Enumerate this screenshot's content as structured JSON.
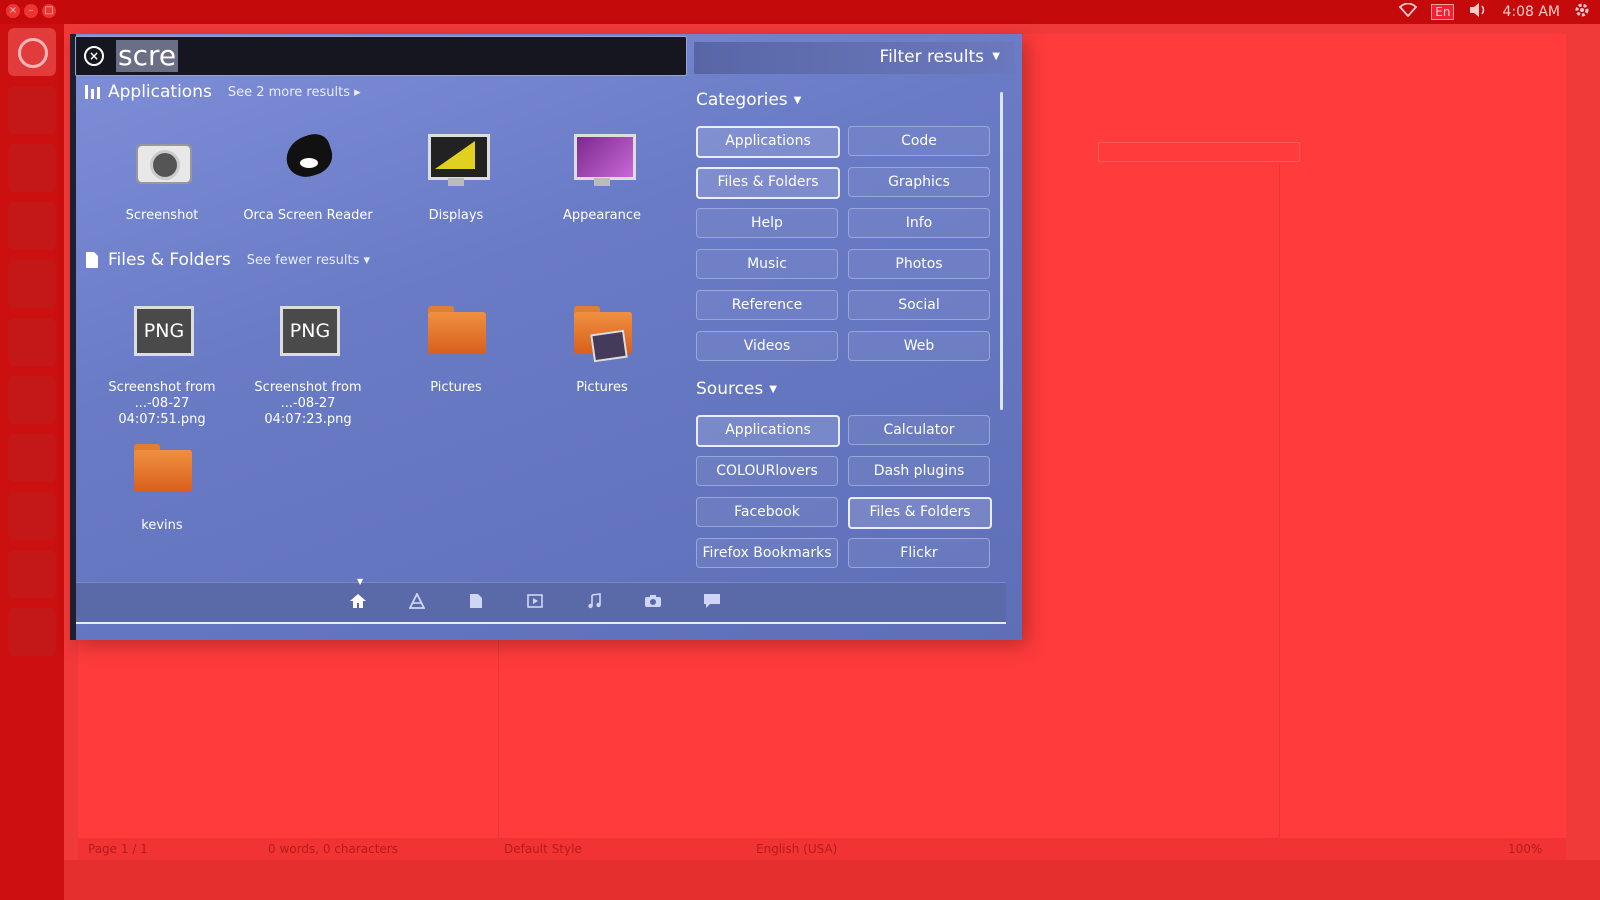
{
  "top_panel": {
    "language": "En",
    "clock": "4:08 AM"
  },
  "icons": {
    "wifi": "wifi-icon",
    "volume": "volume-icon",
    "gear": "gear-icon",
    "close": "close-icon",
    "home": "home-icon"
  },
  "search": {
    "query": "scre"
  },
  "filter": {
    "label": "Filter results"
  },
  "applications_section": {
    "title": "Applications",
    "more": "See 2 more results",
    "items": [
      {
        "label": "Screenshot"
      },
      {
        "label": "Orca Screen Reader"
      },
      {
        "label": "Displays"
      },
      {
        "label": "Appearance"
      }
    ]
  },
  "files_section": {
    "title": "Files & Folders",
    "more": "See fewer results",
    "items": [
      {
        "label1": "Screenshot from",
        "label2": "...-08-27 04:07:51.png",
        "tile": "PNG"
      },
      {
        "label1": "Screenshot from",
        "label2": "...-08-27 04:07:23.png",
        "tile": "PNG"
      },
      {
        "label": "Pictures"
      },
      {
        "label": "Pictures"
      },
      {
        "label": "kevins"
      }
    ]
  },
  "categories": {
    "title": "Categories",
    "buttons": [
      "Applications",
      "Code",
      "Files & Folders",
      "Graphics",
      "Help",
      "Info",
      "Music",
      "Photos",
      "Reference",
      "Social",
      "Videos",
      "Web"
    ],
    "active": [
      "Applications",
      "Files & Folders"
    ]
  },
  "sources": {
    "title": "Sources",
    "buttons": [
      "Applications",
      "Calculator",
      "COLOURlovers",
      "Dash plugins",
      "Facebook",
      "Files & Folders",
      "Firefox Bookmarks",
      "Flickr"
    ],
    "active": [
      "Applications",
      "Files & Folders"
    ]
  },
  "status_bar": {
    "page": "Page 1 / 1",
    "words": "0 words, 0 characters",
    "style": "Default Style",
    "language": "English (USA)",
    "zoom": "100%"
  },
  "colors": {
    "dash_bg": "#6a7bc6",
    "desktop_tint": "#f03a3a"
  }
}
